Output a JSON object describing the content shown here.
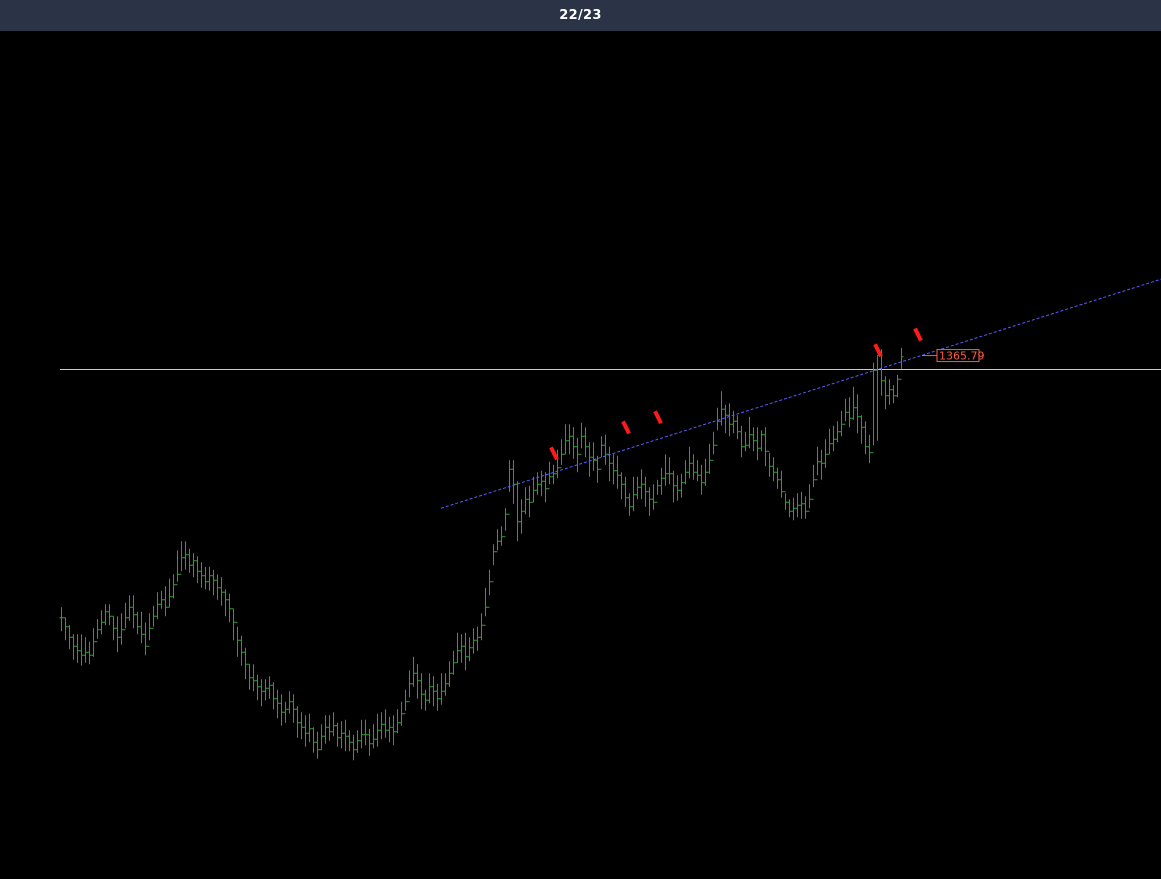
{
  "header": {
    "page_indicator": "22/23"
  },
  "chart_data": {
    "type": "ohlc",
    "title": "",
    "xlabel": "",
    "ylabel": "",
    "ylim": [
      1020,
      1420
    ],
    "bar_count": 216,
    "grid": false,
    "legend": "none",
    "colors": {
      "background": "#000000",
      "bars": "#2fa02f",
      "trendline": "#5a5aff",
      "horizontal_line": "#c8c8dc",
      "markers": "#ff1a1a",
      "price_tag": "#ff5a4a"
    },
    "closes": [
      1191,
      1185,
      1178,
      1172,
      1169,
      1166,
      1168,
      1166,
      1175,
      1183,
      1188,
      1195,
      1192,
      1184,
      1178,
      1183,
      1191,
      1198,
      1193,
      1185,
      1180,
      1172,
      1184,
      1192,
      1200,
      1203,
      1198,
      1205,
      1213,
      1220,
      1231,
      1233,
      1226,
      1229,
      1222,
      1219,
      1215,
      1219,
      1216,
      1211,
      1208,
      1203,
      1197,
      1188,
      1176,
      1168,
      1160,
      1151,
      1149,
      1145,
      1142,
      1144,
      1146,
      1137,
      1134,
      1128,
      1130,
      1135,
      1130,
      1121,
      1118,
      1114,
      1117,
      1108,
      1103,
      1112,
      1118,
      1115,
      1119,
      1111,
      1114,
      1112,
      1108,
      1103,
      1109,
      1113,
      1113,
      1107,
      1110,
      1116,
      1120,
      1116,
      1118,
      1115,
      1121,
      1127,
      1135,
      1147,
      1154,
      1149,
      1140,
      1136,
      1145,
      1142,
      1137,
      1142,
      1147,
      1154,
      1161,
      1169,
      1172,
      1165,
      1171,
      1176,
      1178,
      1186,
      1198,
      1215,
      1235,
      1242,
      1245,
      1260,
      1290,
      1280,
      1255,
      1262,
      1270,
      1268,
      1276,
      1280,
      1282,
      1277,
      1285,
      1287,
      1291,
      1300,
      1309,
      1312,
      1305,
      1300,
      1312,
      1305,
      1298,
      1296,
      1290,
      1306,
      1300,
      1294,
      1289,
      1286,
      1280,
      1271,
      1265,
      1273,
      1278,
      1280,
      1275,
      1270,
      1268,
      1279,
      1284,
      1287,
      1287,
      1279,
      1276,
      1281,
      1288,
      1294,
      1288,
      1286,
      1281,
      1288,
      1296,
      1306,
      1322,
      1330,
      1326,
      1320,
      1322,
      1315,
      1305,
      1306,
      1313,
      1309,
      1304,
      1313,
      1302,
      1292,
      1288,
      1283,
      1275,
      1268,
      1262,
      1264,
      1266,
      1267,
      1262,
      1270,
      1283,
      1295,
      1294,
      1300,
      1307,
      1310,
      1315,
      1320,
      1328,
      1324,
      1331,
      1325,
      1318,
      1305,
      1301,
      1356,
      1366,
      1349,
      1339,
      1343,
      1339,
      1350,
      1365
    ],
    "highs": [
      1198,
      1191,
      1186,
      1180,
      1180,
      1180,
      1178,
      1175,
      1184,
      1190,
      1196,
      1200,
      1200,
      1192,
      1192,
      1194,
      1201,
      1206,
      1206,
      1195,
      1195,
      1188,
      1194,
      1199,
      1208,
      1209,
      1212,
      1217,
      1220,
      1236,
      1242,
      1242,
      1237,
      1234,
      1232,
      1228,
      1225,
      1225,
      1223,
      1220,
      1218,
      1210,
      1207,
      1197,
      1185,
      1179,
      1171,
      1160,
      1160,
      1153,
      1150,
      1150,
      1152,
      1148,
      1143,
      1140,
      1135,
      1142,
      1140,
      1132,
      1128,
      1126,
      1127,
      1118,
      1115,
      1120,
      1126,
      1126,
      1128,
      1121,
      1122,
      1123,
      1116,
      1113,
      1116,
      1123,
      1123,
      1117,
      1120,
      1127,
      1128,
      1130,
      1125,
      1126,
      1130,
      1135,
      1143,
      1156,
      1165,
      1160,
      1154,
      1143,
      1154,
      1152,
      1147,
      1154,
      1154,
      1162,
      1169,
      1181,
      1180,
      1181,
      1178,
      1184,
      1185,
      1194,
      1211,
      1223,
      1240,
      1250,
      1252,
      1264,
      1296,
      1296,
      1282,
      1270,
      1278,
      1279,
      1285,
      1288,
      1289,
      1288,
      1295,
      1293,
      1303,
      1310,
      1320,
      1320,
      1318,
      1311,
      1321,
      1318,
      1308,
      1308,
      1299,
      1312,
      1313,
      1305,
      1300,
      1299,
      1288,
      1285,
      1274,
      1285,
      1285,
      1290,
      1285,
      1278,
      1280,
      1283,
      1291,
      1300,
      1298,
      1289,
      1286,
      1287,
      1296,
      1305,
      1300,
      1296,
      1293,
      1297,
      1307,
      1315,
      1331,
      1342,
      1333,
      1334,
      1329,
      1326,
      1319,
      1315,
      1325,
      1318,
      1318,
      1316,
      1318,
      1301,
      1298,
      1291,
      1289,
      1274,
      1270,
      1271,
      1274,
      1275,
      1272,
      1280,
      1293,
      1305,
      1303,
      1310,
      1317,
      1319,
      1322,
      1329,
      1337,
      1338,
      1345,
      1340,
      1326,
      1322,
      1313,
      1361,
      1366,
      1370,
      1352,
      1350,
      1346,
      1353,
      1371
    ],
    "lows": [
      1182,
      1176,
      1170,
      1163,
      1161,
      1159,
      1161,
      1160,
      1165,
      1177,
      1180,
      1186,
      1186,
      1176,
      1168,
      1173,
      1184,
      1189,
      1184,
      1180,
      1174,
      1166,
      1176,
      1185,
      1190,
      1197,
      1192,
      1198,
      1204,
      1215,
      1222,
      1223,
      1221,
      1218,
      1214,
      1211,
      1210,
      1209,
      1206,
      1203,
      1199,
      1192,
      1188,
      1176,
      1165,
      1159,
      1150,
      1143,
      1142,
      1136,
      1132,
      1136,
      1137,
      1130,
      1124,
      1119,
      1121,
      1127,
      1121,
      1111,
      1110,
      1105,
      1108,
      1101,
      1097,
      1103,
      1107,
      1109,
      1112,
      1105,
      1104,
      1102,
      1102,
      1096,
      1101,
      1104,
      1106,
      1099,
      1104,
      1105,
      1110,
      1111,
      1108,
      1106,
      1114,
      1119,
      1129,
      1138,
      1145,
      1137,
      1130,
      1129,
      1134,
      1132,
      1129,
      1133,
      1139,
      1145,
      1153,
      1161,
      1161,
      1156,
      1162,
      1167,
      1169,
      1176,
      1192,
      1206,
      1226,
      1236,
      1239,
      1249,
      1275,
      1267,
      1242,
      1247,
      1260,
      1258,
      1268,
      1273,
      1272,
      1268,
      1280,
      1280,
      1284,
      1293,
      1300,
      1300,
      1297,
      1288,
      1304,
      1298,
      1285,
      1289,
      1281,
      1298,
      1293,
      1282,
      1280,
      1277,
      1270,
      1265,
      1259,
      1262,
      1270,
      1270,
      1265,
      1259,
      1263,
      1273,
      1273,
      1279,
      1280,
      1268,
      1269,
      1271,
      1280,
      1284,
      1283,
      1282,
      1273,
      1279,
      1287,
      1300,
      1316,
      1319,
      1314,
      1312,
      1314,
      1310,
      1298,
      1302,
      1304,
      1302,
      1296,
      1302,
      1292,
      1285,
      1282,
      1277,
      1271,
      1263,
      1258,
      1256,
      1258,
      1257,
      1257,
      1264,
      1278,
      1286,
      1283,
      1291,
      1300,
      1302,
      1308,
      1312,
      1322,
      1318,
      1323,
      1314,
      1307,
      1300,
      1294,
      1306,
      1309,
      1339,
      1330,
      1333,
      1334,
      1338,
      1357
    ],
    "annotations": {
      "horizontal_line_value": 1356.5,
      "trendline": {
        "from_bar": 95,
        "from_value": 1264,
        "to_bar": 215,
        "to_value": 1365.79,
        "extend_to_bar": 285
      },
      "price_label": "1365.79",
      "markers": [
        {
          "bar": 124,
          "above": 8
        },
        {
          "bar": 142,
          "above": 10
        },
        {
          "bar": 150,
          "above": 10
        },
        {
          "bar": 205,
          "above": 8
        },
        {
          "bar": 215,
          "above": 10
        }
      ]
    }
  }
}
